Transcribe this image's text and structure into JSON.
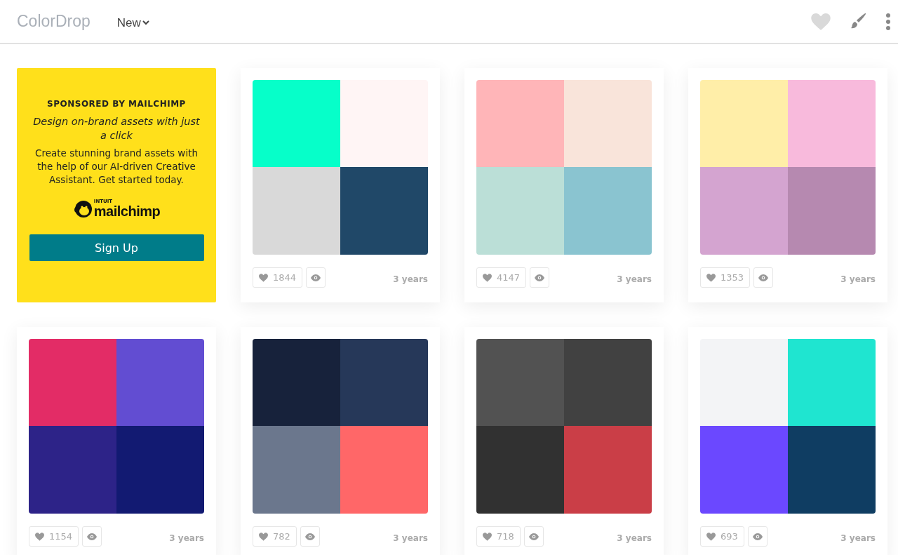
{
  "header": {
    "logo": "ColorDrop",
    "sort_menu": "New"
  },
  "sponsor": {
    "kicker": "SPONSORED BY MAILCHIMP",
    "headline": "Design on-brand assets with just a click",
    "body": "Create stunning brand assets with the help of our AI-driven Creative Assistant. Get started today.",
    "logo_small": "INTUIT",
    "logo_word": "mailchimp",
    "button": "Sign Up"
  },
  "palettes": [
    {
      "swatches": [
        {
          "color": "#06ffc9"
        },
        {
          "color": "#fff5f5"
        },
        {
          "color": "#d9d9d9"
        },
        {
          "color": "#204868"
        }
      ],
      "likes": "1844",
      "age": "3 years"
    },
    {
      "swatches": [
        {
          "color": "#ffb5b8"
        },
        {
          "color": "#f9e4da"
        },
        {
          "color": "#bbdfd7"
        },
        {
          "color": "#8ac4d0"
        }
      ],
      "likes": "4147",
      "age": "3 years"
    },
    {
      "swatches": [
        {
          "color": "#ffeea8"
        },
        {
          "color": "#f8badc"
        },
        {
          "color": "#d4a4d0"
        },
        {
          "color": "#b689b0"
        }
      ],
      "likes": "1353",
      "age": "3 years"
    },
    {
      "swatches": [
        {
          "color": "#e32c66"
        },
        {
          "color": "#624dd2"
        },
        {
          "color": "#2d2388"
        },
        {
          "color": "#121a72"
        }
      ],
      "likes": "1154",
      "age": "3 years"
    },
    {
      "swatches": [
        {
          "color": "#17223b"
        },
        {
          "color": "#263859"
        },
        {
          "color": "#6b778d"
        },
        {
          "color": "#ff6768"
        }
      ],
      "likes": "782",
      "age": "3 years"
    },
    {
      "swatches": [
        {
          "color": "#525252"
        },
        {
          "color": "#414141"
        },
        {
          "color": "#313131"
        },
        {
          "color": "#ca3e47"
        }
      ],
      "likes": "718",
      "age": "3 years"
    },
    {
      "swatches": [
        {
          "color": "#f3f4f6"
        },
        {
          "color": "#1fe5d0"
        },
        {
          "color": "#6b48ff"
        },
        {
          "color": "#0f3d62"
        }
      ],
      "likes": "693",
      "age": "3 years"
    }
  ]
}
